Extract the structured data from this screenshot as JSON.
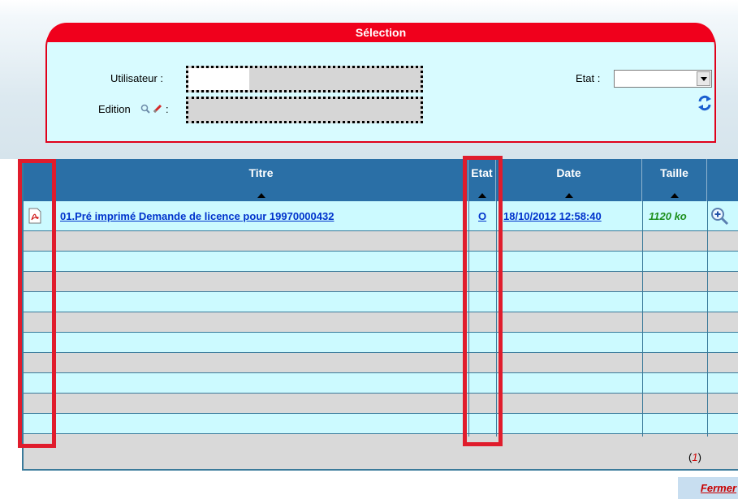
{
  "selection": {
    "title": "Sélection",
    "user_label": "Utilisateur :",
    "edition_label": "Edition",
    "edition_colon": ":",
    "state_label": "Etat :",
    "state_value": ""
  },
  "table": {
    "columns": [
      "Titre",
      "Etat",
      "Date",
      "Taille"
    ],
    "rows": [
      {
        "icon": "pdf-icon",
        "title": "01.Pré imprimé Demande de licence pour 19970000432",
        "state": "O",
        "date": "18/10/2012 12:58:40",
        "size": "1120 ko",
        "action_icon": "zoom-in-icon"
      }
    ]
  },
  "pager": {
    "open": "(",
    "page": "1",
    "close": ")"
  },
  "footer": {
    "close_label": "Fermer"
  },
  "colors": {
    "selection_red": "#f0001c",
    "header_blue": "#2a6fa6",
    "row_cyan": "#ccfaff",
    "highlight_red": "#e01c2c"
  }
}
